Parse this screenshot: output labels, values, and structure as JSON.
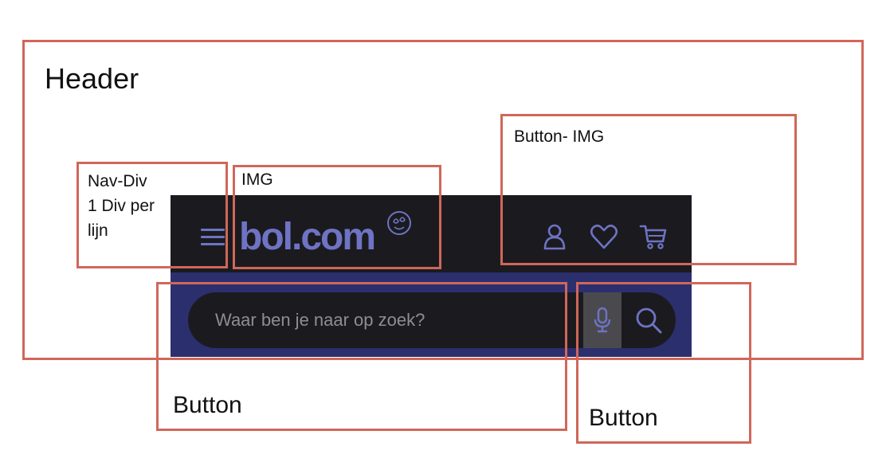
{
  "annotations": {
    "header": "Header",
    "nav_div_lines": [
      "Nav-Div",
      "1 Div per",
      "lijn"
    ],
    "img": "IMG",
    "button_img": "Button- IMG",
    "button_search_field": "Button",
    "button_search_actions": "Button"
  },
  "mockup": {
    "logo_text": "bol.com",
    "search_placeholder": "Waar ben je naar op zoek?",
    "icons": {
      "menu": "hamburger-menu-icon",
      "account": "user-icon",
      "wishlist": "heart-icon",
      "basket": "shopping-cart-icon",
      "voice": "microphone-icon",
      "search": "search-icon",
      "logo_mark": "smiley-circle-icon"
    }
  },
  "colors": {
    "annotation_border": "#d0675a",
    "header_bg": "#1b1b1f",
    "search_bar_bg": "#2c2f6e",
    "accent": "#6e73c4",
    "placeholder_text": "#8d8d92",
    "mic_button_bg": "#4a4a4e"
  }
}
